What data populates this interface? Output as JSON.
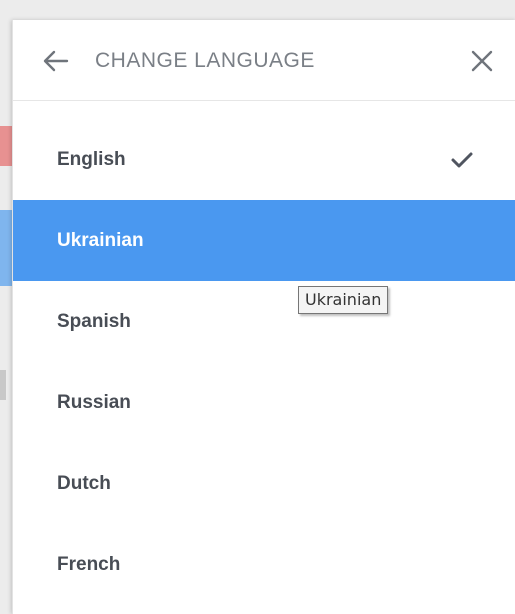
{
  "header": {
    "title": "CHANGE LANGUAGE",
    "back_icon": "arrow-left-icon",
    "close_icon": "close-icon"
  },
  "languages": [
    {
      "label": "English",
      "checked": true,
      "highlighted": false
    },
    {
      "label": "Ukrainian",
      "checked": false,
      "highlighted": true
    },
    {
      "label": "Spanish",
      "checked": false,
      "highlighted": false
    },
    {
      "label": "Russian",
      "checked": false,
      "highlighted": false
    },
    {
      "label": "Dutch",
      "checked": false,
      "highlighted": false
    },
    {
      "label": "French",
      "checked": false,
      "highlighted": false
    }
  ],
  "tooltip": {
    "text": "Ukrainian"
  },
  "colors": {
    "highlight": "#4a98f0",
    "text": "#484d55",
    "title": "#7a7f86"
  }
}
